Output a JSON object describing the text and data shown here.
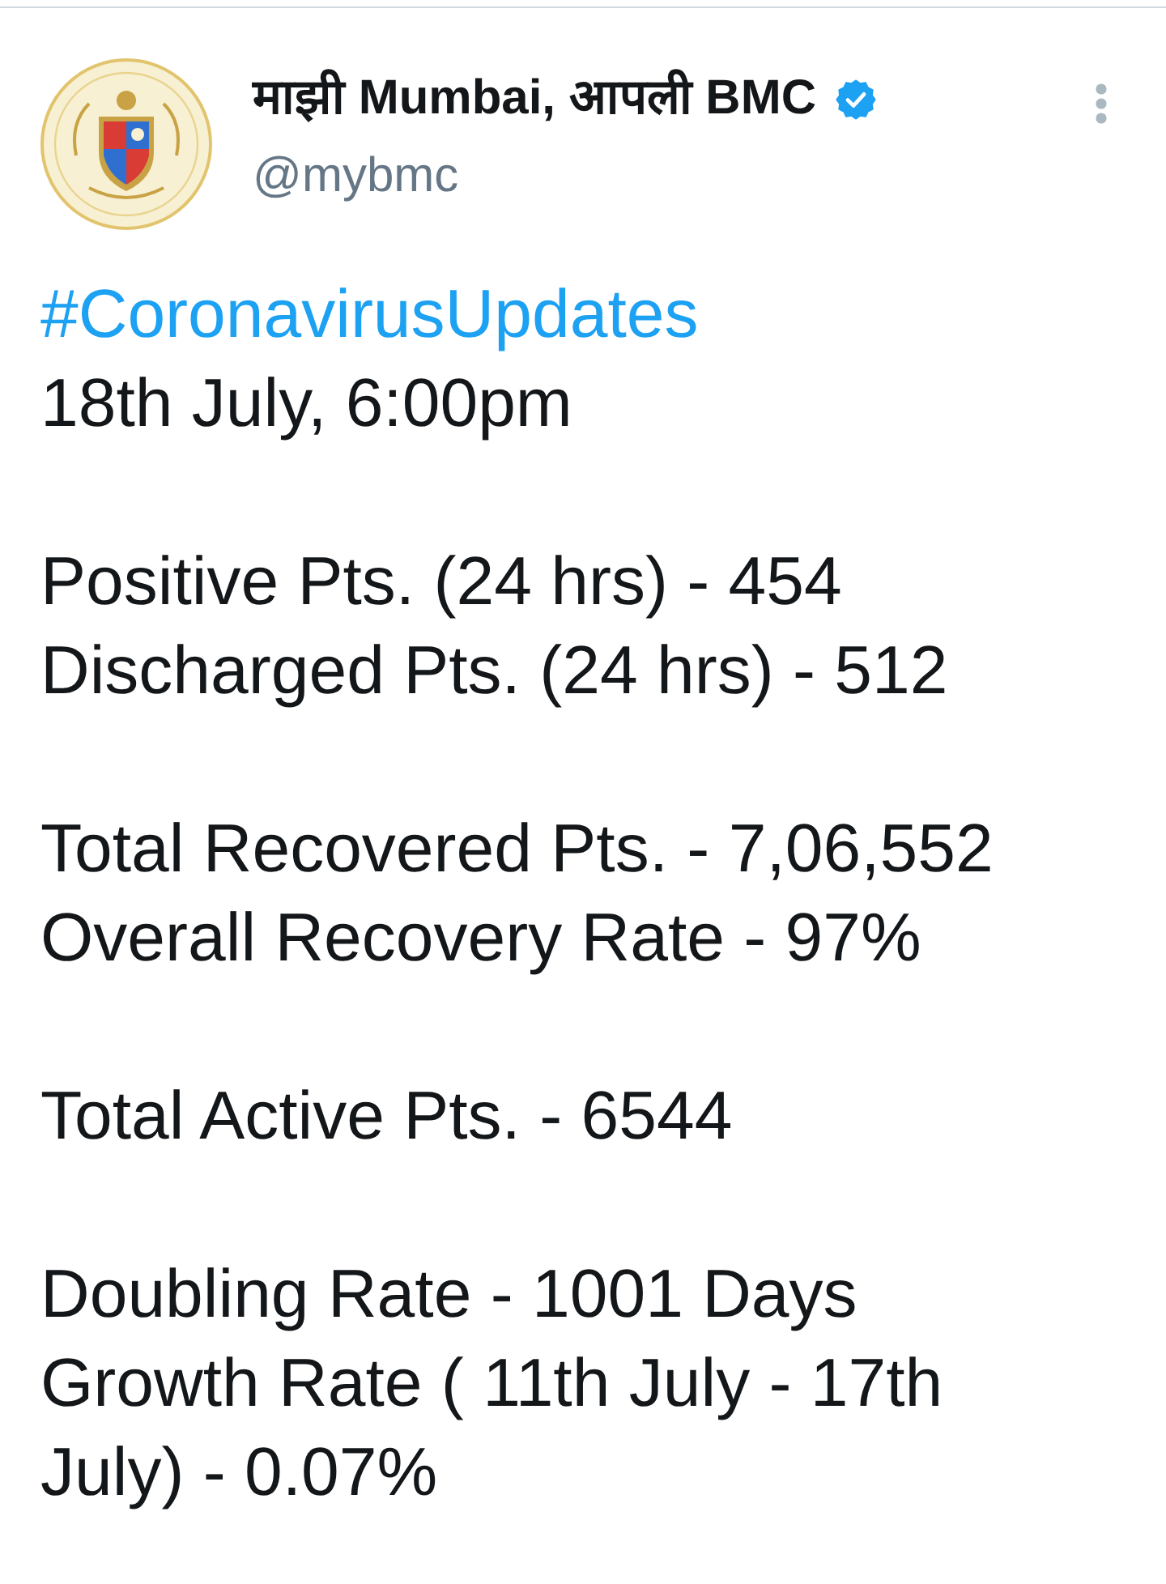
{
  "account": {
    "display_name": "माझी Mumbai, आपली BMC",
    "verified": true,
    "handle": "@mybmc"
  },
  "tweet": {
    "hashtag": "#CoronavirusUpdates",
    "paragraphs": [
      [
        "18th July, 6:00pm"
      ],
      [
        "Positive Pts. (24 hrs) - 454",
        "Discharged Pts. (24 hrs) - 512"
      ],
      [
        "Total Recovered Pts. - 7,06,552",
        "Overall Recovery Rate - 97%"
      ],
      [
        "Total Active Pts. - 6544"
      ],
      [
        "Doubling Rate - 1001 Days",
        "Growth Rate ( 11th July - 17th July) - 0.07%"
      ]
    ]
  }
}
